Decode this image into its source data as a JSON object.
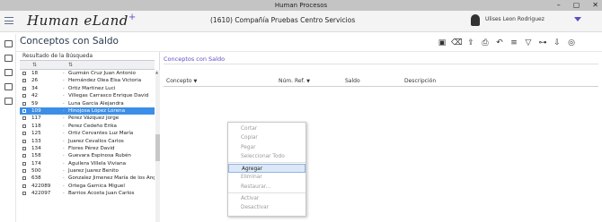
{
  "window": {
    "title": "Human Procesos"
  },
  "header": {
    "logo": "Human eLand",
    "logo_plus": "+",
    "company": "(1610) Compañía Pruebas Centro Servicios",
    "user_name": "Ulises Leon Rodriguez"
  },
  "page": {
    "title": "Conceptos con Saldo"
  },
  "toolbar": {
    "icons": [
      "save-icon",
      "clear-icon",
      "export-icon",
      "print-icon",
      "undo-icon",
      "sort-icon",
      "filter-icon",
      "hierarchy-icon",
      "download-icon",
      "search-user-icon"
    ]
  },
  "list": {
    "title": "Resultado de la Búsqueda",
    "rows": [
      {
        "code": "18",
        "desc": "Guzmán Cruz Juan Antonio"
      },
      {
        "code": "26",
        "desc": "Hernández Olea Elsa Victoria"
      },
      {
        "code": "34",
        "desc": "Ortiz Martinez Luci"
      },
      {
        "code": "42",
        "desc": "Villegas Carrasco Enrique David"
      },
      {
        "code": "59",
        "desc": "Luna Garcia Alejandra"
      },
      {
        "code": "109",
        "desc": "Hinojosa López Lorena",
        "selected": true
      },
      {
        "code": "117",
        "desc": "Pérez Vázquez Jorge"
      },
      {
        "code": "118",
        "desc": "Perez Cedeño Erika"
      },
      {
        "code": "125",
        "desc": "Ortiz Cervantes Luz María"
      },
      {
        "code": "133",
        "desc": "Juarez Cevallos Carlos"
      },
      {
        "code": "134",
        "desc": "Flores Pérez David"
      },
      {
        "code": "158",
        "desc": "Guevara Espinosa Rubén"
      },
      {
        "code": "174",
        "desc": "Aguilera Villela Viviana"
      },
      {
        "code": "500",
        "desc": "Juarez Juarez Benito"
      },
      {
        "code": "638",
        "desc": "Gonzalez Jimenez María de los Ange"
      },
      {
        "code": "422089",
        "desc": "Ortega Garnica Miguel"
      },
      {
        "code": "422097",
        "desc": "Barrios Acosta Juan Carlos"
      }
    ]
  },
  "detail": {
    "title": "Conceptos con Saldo",
    "columns": {
      "concepto": "Concepto",
      "num_ref": "Núm. Ref.",
      "saldo": "Saldo",
      "descripcion": "Descripción"
    }
  },
  "context_menu": {
    "items": [
      {
        "label": "Cortar",
        "enabled": false
      },
      {
        "label": "Copiar",
        "enabled": false
      },
      {
        "label": "Pegar",
        "enabled": false
      },
      {
        "label": "Seleccionar Todo",
        "enabled": false
      },
      {
        "label": "Agregar",
        "enabled": true,
        "highlighted": true
      },
      {
        "label": "Eliminar",
        "enabled": false
      },
      {
        "label": "Restaurar...",
        "enabled": false
      },
      {
        "label": "Activar",
        "enabled": false
      },
      {
        "label": "Desactivar",
        "enabled": false
      }
    ]
  },
  "colors": {
    "accent": "#5a4fc0",
    "selection": "#3d8ee6",
    "titlebar": "#c4c4c4"
  }
}
